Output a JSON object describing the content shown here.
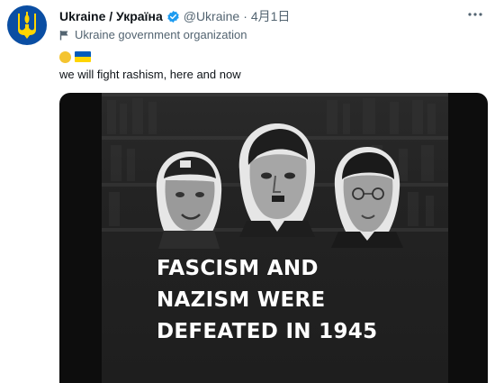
{
  "tweet": {
    "display_name": "Ukraine / Україна",
    "handle": "@Ukraine",
    "separator": "·",
    "date": "4月1日",
    "account_label": "Ukraine government organization",
    "text": "we will fight rashism, here and now",
    "emojis": [
      "sun-emoji",
      "ukraine-flag-emoji"
    ],
    "media": {
      "headline_lines": [
        "FASCISM AND",
        "NAZISM WERE",
        "DEFEATED IN 1945"
      ]
    }
  },
  "colors": {
    "avatar_bg": "#0a4ea3",
    "trident": "#ffd500",
    "verified": "#1d9bf0",
    "secondary_text": "#536471",
    "media_bg": "#0d0d0d"
  },
  "icons": {
    "avatar": "ukraine-trident-icon",
    "verified": "verified-badge-icon",
    "label": "government-flag-icon",
    "more": "more-options-icon"
  }
}
